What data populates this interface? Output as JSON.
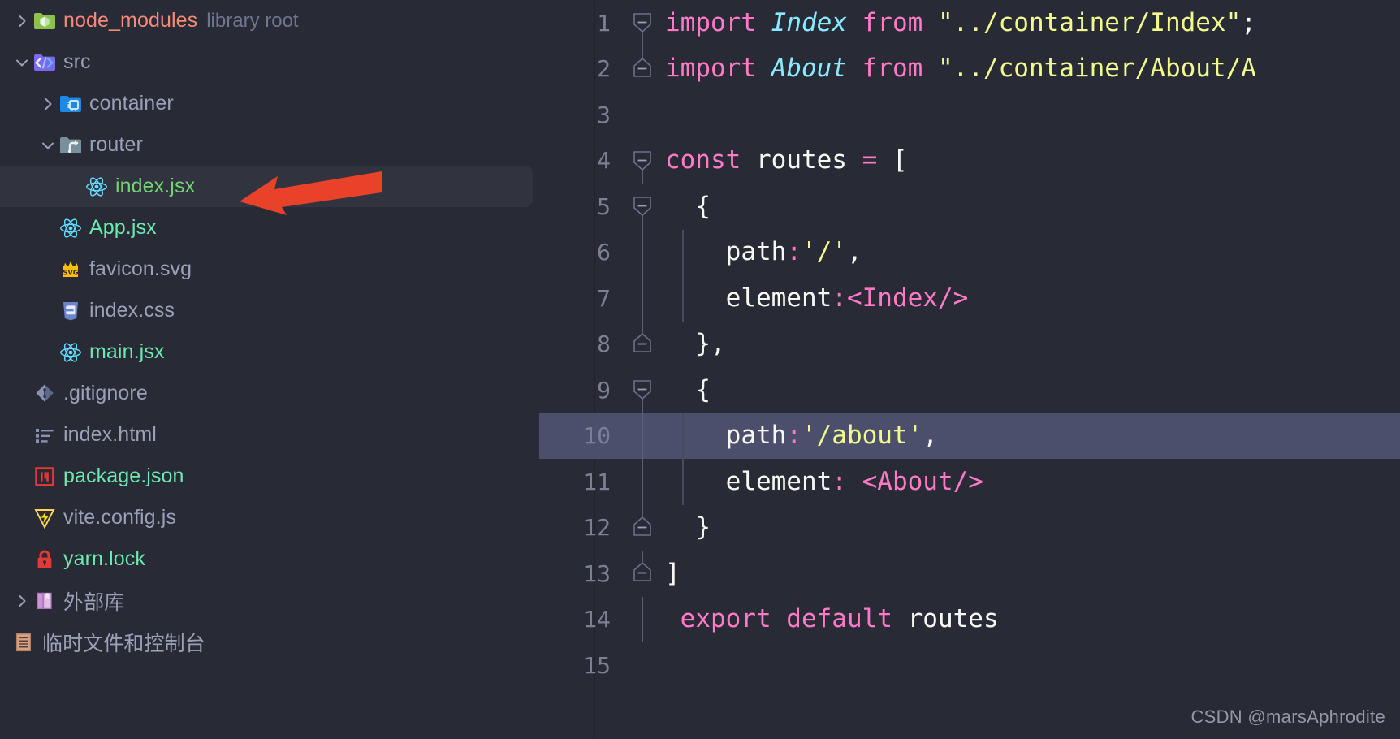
{
  "theme": {
    "background": "#282A36",
    "selection": "#31333F",
    "caret_line": "#4C4F6B",
    "gutter_text": "#7C8094",
    "accent_pink": "#FF79C6",
    "accent_cyan": "#8BE9FD",
    "accent_yellow": "#F1FA8C",
    "arrow_red": "#E8432A"
  },
  "sidebar": {
    "items": [
      {
        "label": "node_modules",
        "sub": "library root",
        "icon": "folder-node-modules-icon",
        "twisty": "chevron-right",
        "depth": 0,
        "color": "salmon",
        "selected": false
      },
      {
        "label": "src",
        "sub": "",
        "icon": "folder-src-icon",
        "twisty": "chevron-down",
        "depth": 0,
        "color": "grey",
        "selected": false
      },
      {
        "label": "container",
        "sub": "",
        "icon": "folder-container-icon",
        "twisty": "chevron-right",
        "depth": 1,
        "color": "grey",
        "selected": false
      },
      {
        "label": "router",
        "sub": "",
        "icon": "folder-router-icon",
        "twisty": "chevron-down",
        "depth": 1,
        "color": "grey",
        "selected": false
      },
      {
        "label": "index.jsx",
        "sub": "",
        "icon": "react-jsx-icon",
        "twisty": "none",
        "depth": 2,
        "color": "green",
        "selected": true
      },
      {
        "label": "App.jsx",
        "sub": "",
        "icon": "react-jsx-icon",
        "twisty": "none",
        "depth": 1,
        "color": "mint",
        "selected": false
      },
      {
        "label": "favicon.svg",
        "sub": "",
        "icon": "svg-file-icon",
        "twisty": "none",
        "depth": 1,
        "color": "grey",
        "selected": false
      },
      {
        "label": "index.css",
        "sub": "",
        "icon": "css-file-icon",
        "twisty": "none",
        "depth": 1,
        "color": "grey",
        "selected": false
      },
      {
        "label": "main.jsx",
        "sub": "",
        "icon": "react-jsx-icon",
        "twisty": "none",
        "depth": 1,
        "color": "mint",
        "selected": false
      },
      {
        "label": ".gitignore",
        "sub": "",
        "icon": "git-file-icon",
        "twisty": "none",
        "depth": 0,
        "color": "grey",
        "selected": false
      },
      {
        "label": "index.html",
        "sub": "",
        "icon": "html-file-icon",
        "twisty": "none",
        "depth": 0,
        "color": "grey",
        "selected": false
      },
      {
        "label": "package.json",
        "sub": "",
        "icon": "npm-package-icon",
        "twisty": "none",
        "depth": 0,
        "color": "mint",
        "selected": false
      },
      {
        "label": "vite.config.js",
        "sub": "",
        "icon": "vite-file-icon",
        "twisty": "none",
        "depth": 0,
        "color": "grey",
        "selected": false
      },
      {
        "label": "yarn.lock",
        "sub": "",
        "icon": "lock-file-icon",
        "twisty": "none",
        "depth": 0,
        "color": "mint",
        "selected": false
      },
      {
        "label": "外部库",
        "sub": "",
        "icon": "external-libraries-icon",
        "twisty": "chevron-right",
        "depth": -1,
        "color": "grey",
        "selected": false
      },
      {
        "label": "临时文件和控制台",
        "sub": "",
        "icon": "scratches-consoles-icon",
        "twisty": "none",
        "depth": -1,
        "color": "grey",
        "selected": false
      }
    ]
  },
  "editor": {
    "caret_line_number": 10,
    "lines": [
      {
        "n": "1",
        "tokens": [
          {
            "t": "import ",
            "c": "k"
          },
          {
            "t": "Index",
            "c": "cls"
          },
          {
            "t": " ",
            "c": "pl"
          },
          {
            "t": "from",
            "c": "k"
          },
          {
            "t": " ",
            "c": "pl"
          },
          {
            "t": "\"../container/Index\"",
            "c": "str"
          },
          {
            "t": ";",
            "c": "pl"
          }
        ]
      },
      {
        "n": "2",
        "tokens": [
          {
            "t": "import ",
            "c": "k"
          },
          {
            "t": "About",
            "c": "cls"
          },
          {
            "t": " ",
            "c": "pl"
          },
          {
            "t": "from",
            "c": "k"
          },
          {
            "t": " ",
            "c": "pl"
          },
          {
            "t": "\"../container/About/A",
            "c": "str"
          }
        ]
      },
      {
        "n": "3",
        "tokens": []
      },
      {
        "n": "4",
        "tokens": [
          {
            "t": "const",
            "c": "k"
          },
          {
            "t": " routes ",
            "c": "pl"
          },
          {
            "t": "=",
            "c": "k"
          },
          {
            "t": " [",
            "c": "pl"
          }
        ]
      },
      {
        "n": "5",
        "tokens": [
          {
            "t": "  {",
            "c": "pl"
          }
        ]
      },
      {
        "n": "6",
        "tokens": [
          {
            "t": "    path",
            "c": "pl"
          },
          {
            "t": ":",
            "c": "colon"
          },
          {
            "t": "'/'",
            "c": "str"
          },
          {
            "t": ",",
            "c": "pl"
          }
        ]
      },
      {
        "n": "7",
        "tokens": [
          {
            "t": "    element",
            "c": "pl"
          },
          {
            "t": ":",
            "c": "colon"
          },
          {
            "t": "<Index/>",
            "c": "jsx"
          }
        ]
      },
      {
        "n": "8",
        "tokens": [
          {
            "t": "  },",
            "c": "pl"
          }
        ]
      },
      {
        "n": "9",
        "tokens": [
          {
            "t": "  {",
            "c": "pl"
          }
        ]
      },
      {
        "n": "10",
        "tokens": [
          {
            "t": "    path",
            "c": "pl"
          },
          {
            "t": ":",
            "c": "colon"
          },
          {
            "t": "'/about'",
            "c": "str"
          },
          {
            "t": ",",
            "c": "pl"
          }
        ]
      },
      {
        "n": "11",
        "tokens": [
          {
            "t": "    element",
            "c": "pl"
          },
          {
            "t": ":",
            "c": "colon"
          },
          {
            "t": " <About/>",
            "c": "jsx"
          }
        ]
      },
      {
        "n": "12",
        "tokens": [
          {
            "t": "  }",
            "c": "pl"
          }
        ]
      },
      {
        "n": "13",
        "tokens": [
          {
            "t": "]",
            "c": "pl"
          }
        ]
      },
      {
        "n": "14",
        "tokens": [
          {
            "t": " export default",
            "c": "k"
          },
          {
            "t": " routes",
            "c": "pl"
          }
        ]
      },
      {
        "n": "15",
        "tokens": []
      }
    ]
  },
  "annotation": {
    "arrow_name": "red-pointer-arrow",
    "points_to": "index.jsx"
  },
  "watermark": {
    "text": "CSDN @marsAphrodite"
  }
}
